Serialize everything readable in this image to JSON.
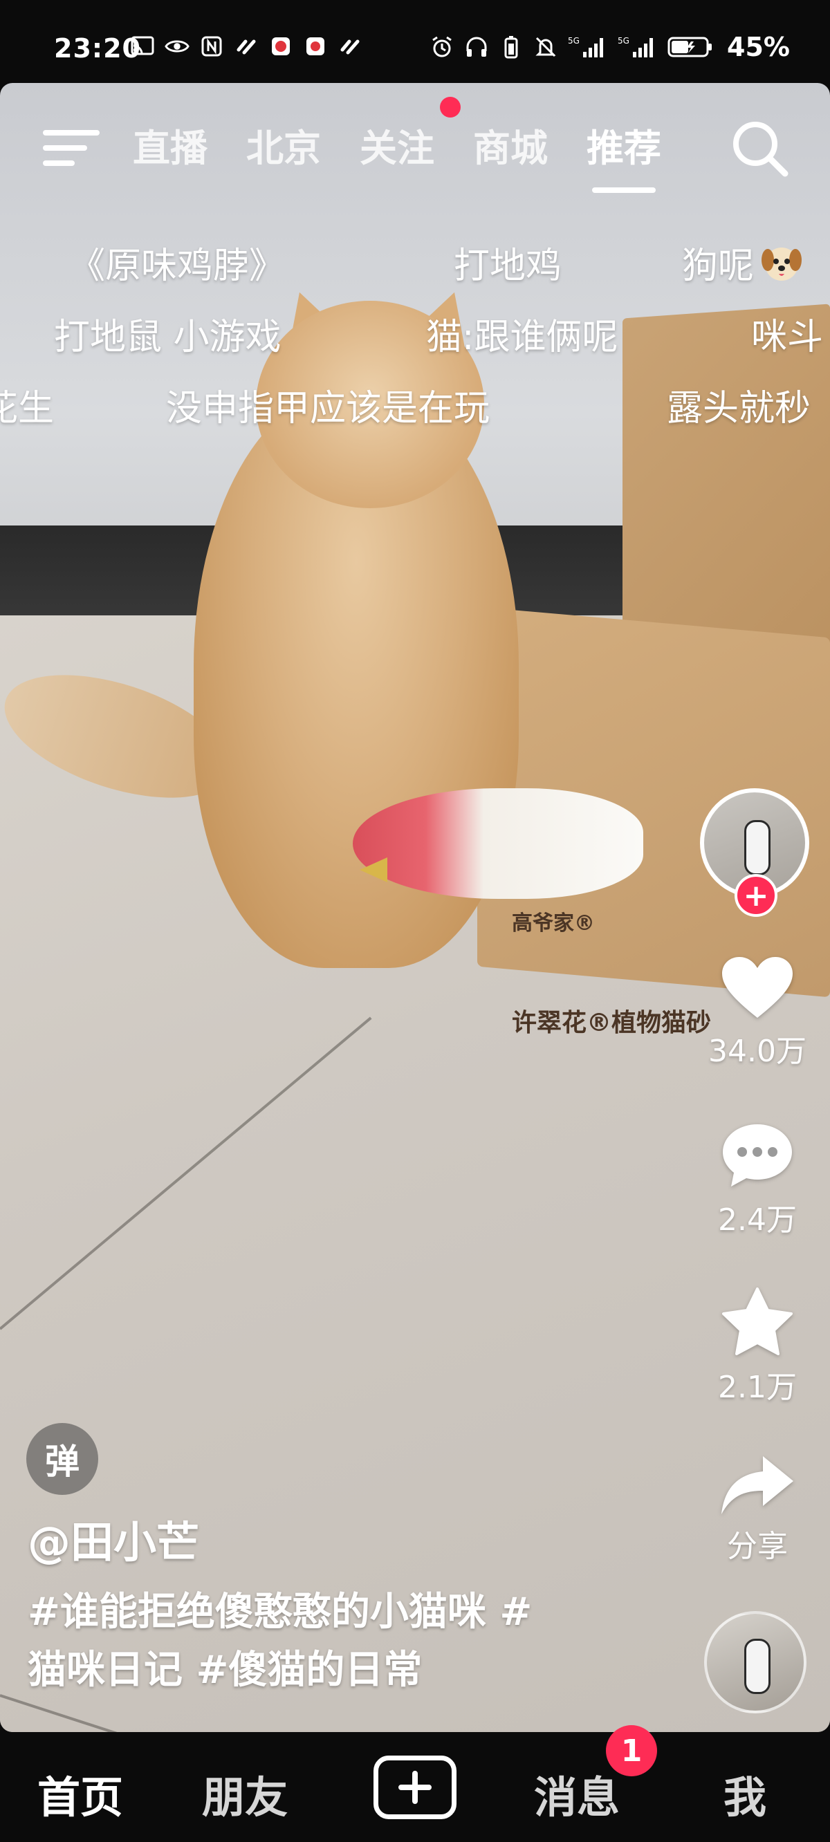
{
  "status_bar": {
    "time": "23:20",
    "left_icons": [
      "cast-icon",
      "eye-icon",
      "nfc-icon",
      "app-icon",
      "app-red-icon",
      "app-red-icon-2",
      "app-icon-2"
    ],
    "right_icons": [
      "alarm-icon",
      "headphones-icon",
      "battery-saver-icon",
      "mute-icon",
      "signal-5g-icon",
      "signal-5g-icon-2",
      "battery-icon"
    ],
    "network_1": "5G",
    "network_2": "5G",
    "battery": "45%"
  },
  "top_nav": {
    "tabs": [
      "直播",
      "北京",
      "关注",
      "商城",
      "推荐"
    ],
    "active_tab": "推荐"
  },
  "danmaku": [
    "《原味鸡脖》",
    "打地鸡",
    "狗呢",
    "打地鼠 小游戏",
    "猫:跟谁俩呢",
    "咪斗",
    "花生",
    "没申指甲应该是在玩",
    "露头就秒"
  ],
  "actions": {
    "likes": "34.0万",
    "comments": "2.4万",
    "favorites": "2.1万",
    "share_label": "分享"
  },
  "video_info": {
    "danmu_toggle": "弹",
    "author": "@田小芒",
    "caption_line1": "#谁能拒绝傻憨憨的小猫咪 #",
    "caption_line2": "猫咪日记 #傻猫的日常"
  },
  "scene_text": {
    "box_brand": "高爷家®",
    "box_product": "许翠花®植物猫砂"
  },
  "bottom_nav": {
    "home": "首页",
    "friends": "朋友",
    "messages": "消息",
    "messages_badge": "1",
    "me": "我"
  },
  "colors": {
    "accent": "#fe2c55",
    "background": "#0b0b0b"
  }
}
